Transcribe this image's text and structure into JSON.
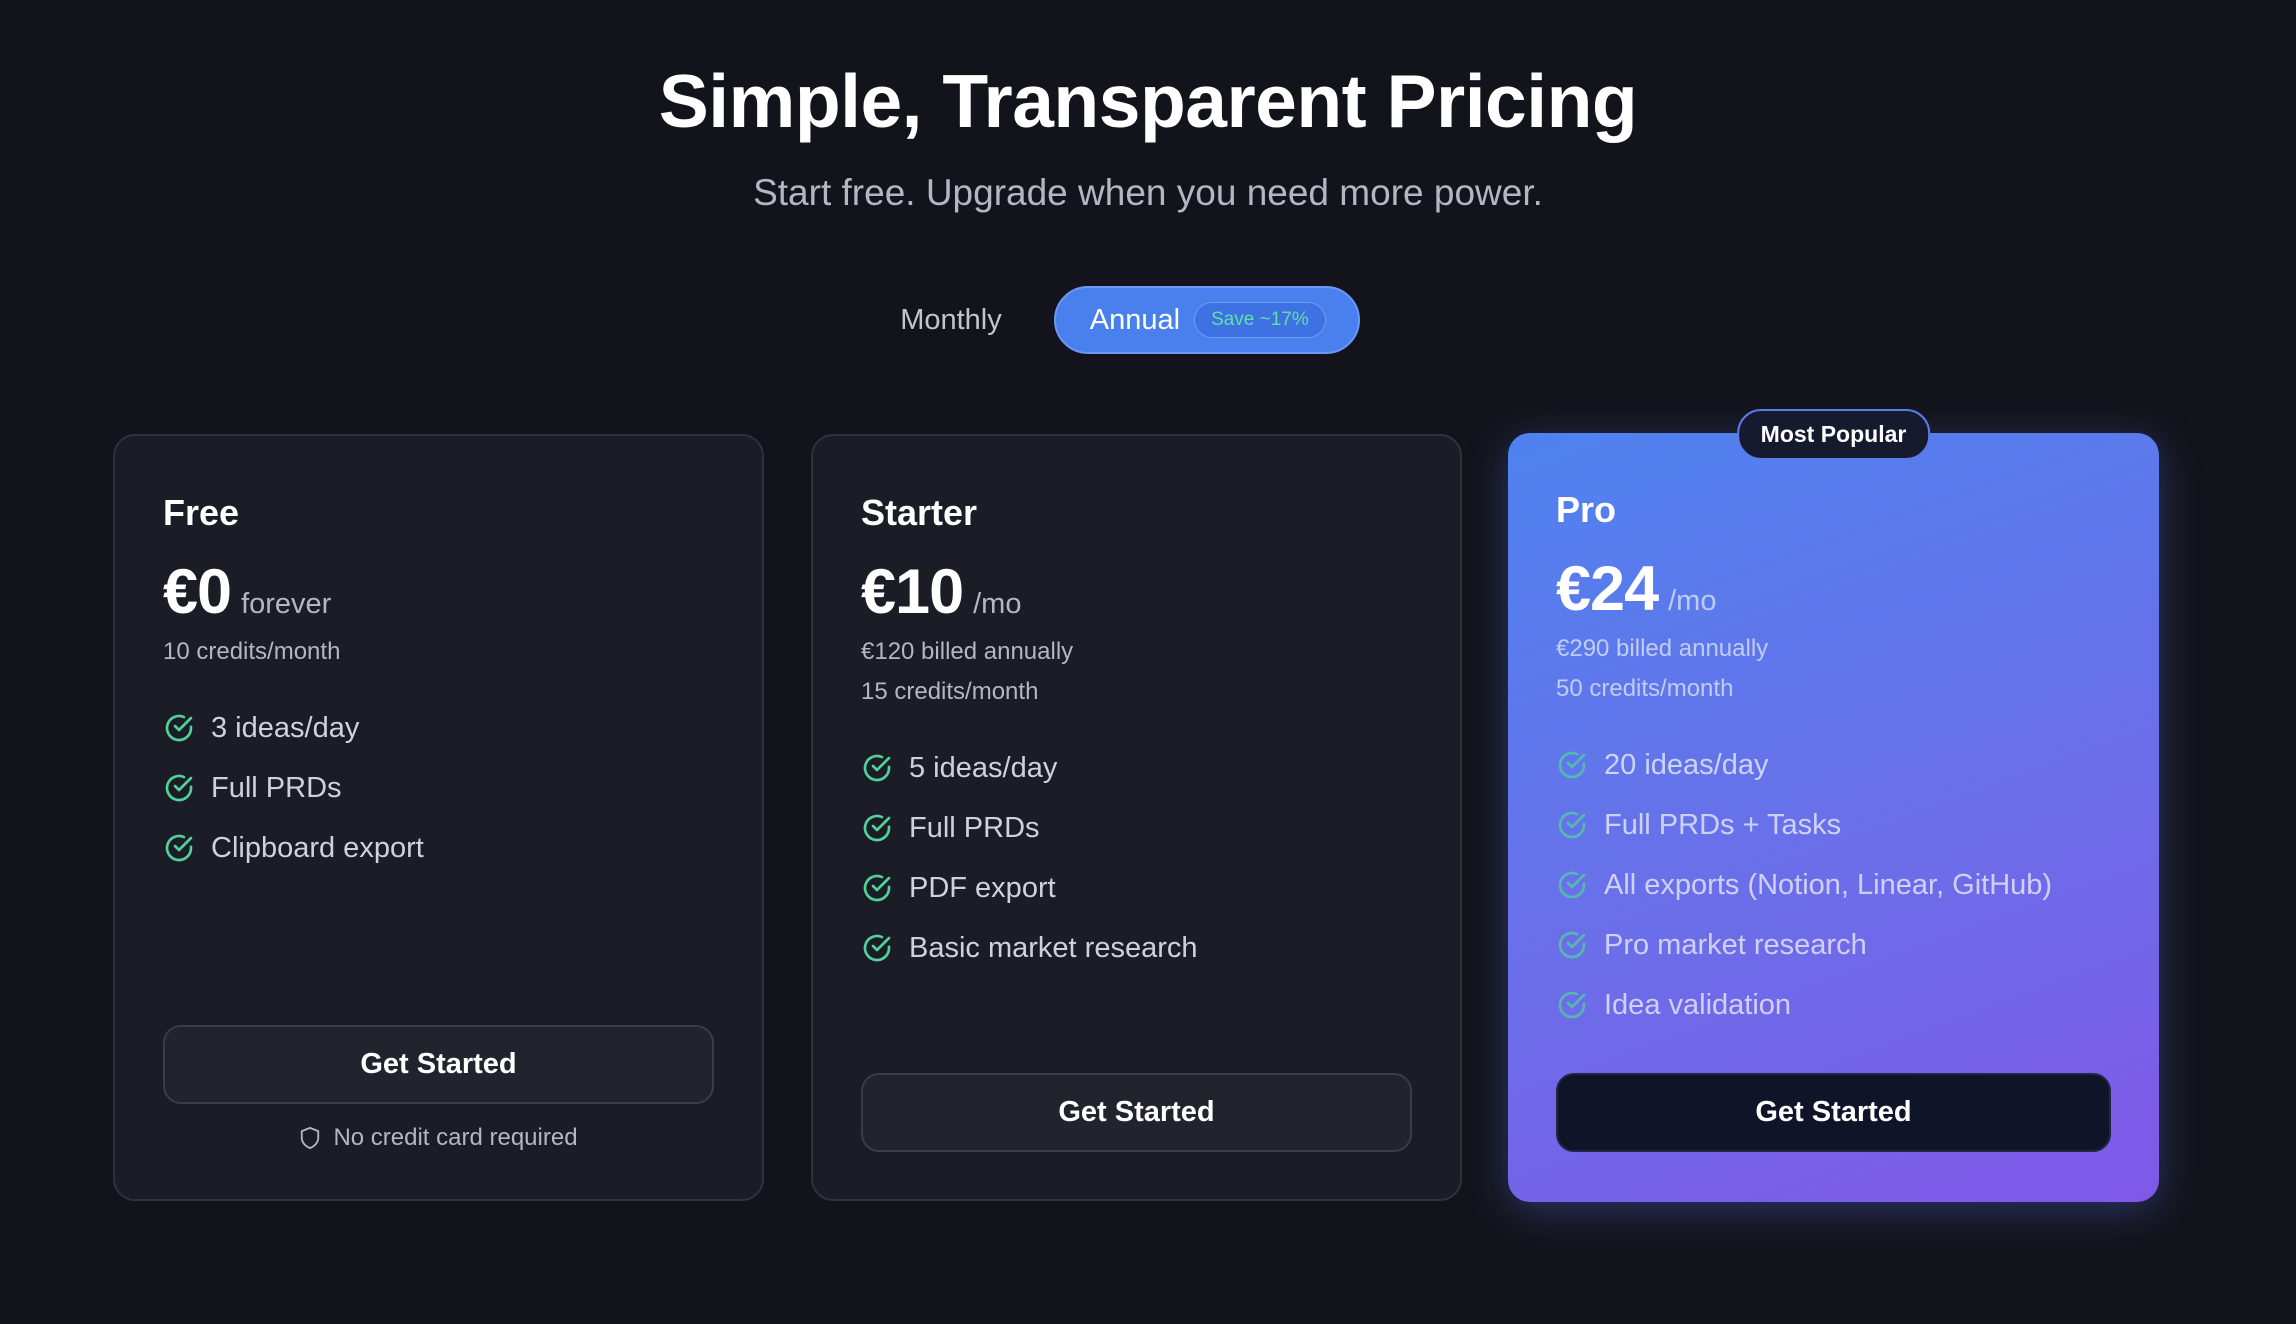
{
  "header": {
    "title": "Simple, Transparent Pricing",
    "subtitle": "Start free. Upgrade when you need more power."
  },
  "billing_toggle": {
    "monthly_label": "Monthly",
    "annual_label": "Annual",
    "save_badge": "Save ~17%",
    "selected": "Annual"
  },
  "colors": {
    "background": "#13141b",
    "accent": "#4a7fee",
    "check": "#4fd19a",
    "pro_gradient_start": "#4f83ef",
    "pro_gradient_end": "#8058e8"
  },
  "plans": [
    {
      "name": "Free",
      "price": "€0",
      "period": "forever",
      "details": [
        "10 credits/month"
      ],
      "features": [
        "3 ideas/day",
        "Full PRDs",
        "Clipboard export"
      ],
      "cta": "Get Started",
      "note": "No credit card required",
      "note_icon": "shield-icon"
    },
    {
      "name": "Starter",
      "price": "€10",
      "period": "/mo",
      "details": [
        "€120 billed annually",
        "15 credits/month"
      ],
      "features": [
        "5 ideas/day",
        "Full PRDs",
        "PDF export",
        "Basic market research"
      ],
      "cta": "Get Started"
    },
    {
      "name": "Pro",
      "badge": "Most Popular",
      "price": "€24",
      "period": "/mo",
      "details": [
        "€290 billed annually",
        "50 credits/month"
      ],
      "features": [
        "20 ideas/day",
        "Full PRDs + Tasks",
        "All exports (Notion, Linear, GitHub)",
        "Pro market research",
        "Idea validation"
      ],
      "cta": "Get Started"
    }
  ]
}
